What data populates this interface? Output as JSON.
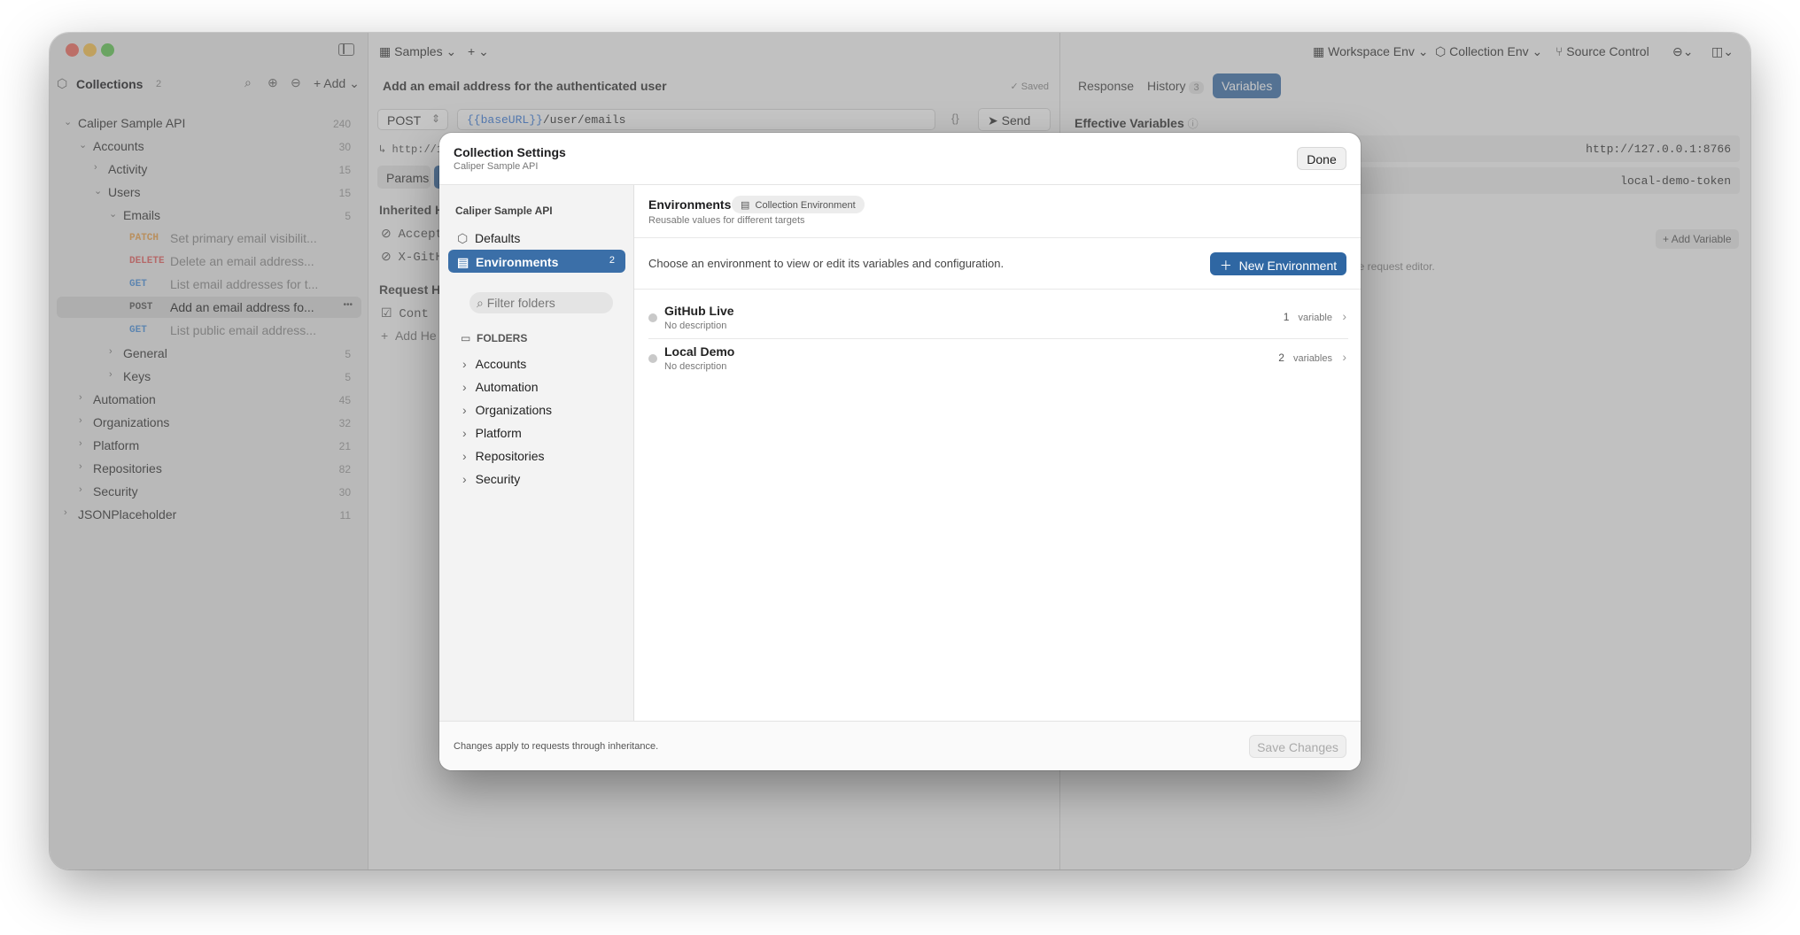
{
  "topbar": {
    "workspace_tab": "Samples",
    "add_tab": "+",
    "workspace_env": "Workspace Env",
    "collection_env": "Collection Env",
    "source_control": "Source Control"
  },
  "sidebar": {
    "title": "Collections",
    "title_count": "2",
    "add_label": "Add",
    "tree": [
      {
        "label": "Caliper Sample API",
        "count": "240"
      },
      {
        "label": "Accounts",
        "count": "30"
      },
      {
        "label": "Activity",
        "count": "15"
      },
      {
        "label": "Users",
        "count": "15"
      },
      {
        "label": "Emails",
        "count": "5"
      },
      {
        "method": "PATCH",
        "label": "Set primary email visibilit...",
        "color": "#e8a04a"
      },
      {
        "method": "DELETE",
        "label": "Delete an email address...",
        "color": "#e26060"
      },
      {
        "method": "GET",
        "label": "List email addresses for t...",
        "color": "#4a90d9"
      },
      {
        "method": "POST",
        "label": "Add an email address fo...",
        "color": "#555555"
      },
      {
        "method": "GET",
        "label": "List public email address...",
        "color": "#4a90d9"
      },
      {
        "label": "General",
        "count": "5"
      },
      {
        "label": "Keys",
        "count": "5"
      },
      {
        "label": "Automation",
        "count": "45"
      },
      {
        "label": "Organizations",
        "count": "32"
      },
      {
        "label": "Platform",
        "count": "21"
      },
      {
        "label": "Repositories",
        "count": "82"
      },
      {
        "label": "Security",
        "count": "30"
      },
      {
        "label": "JSONPlaceholder",
        "count": "11"
      }
    ]
  },
  "request": {
    "title": "Add an email address for the authenticated user",
    "saved": "Saved",
    "method": "POST",
    "url_var": "{{baseURL}}",
    "url_path": "/user/emails",
    "send": "Send",
    "resolved_url": "http://1",
    "params_tab": "Params",
    "inherited_headers": "Inherited H",
    "header1": "Accept",
    "header2": "X-GitH",
    "request_headers": "Request He",
    "header3": "Cont",
    "add_header": "Add He"
  },
  "right_panel": {
    "tabs": [
      "Response",
      "History",
      "Variables"
    ],
    "history_count": "3",
    "effective_vars": "Effective Variables",
    "var1_value": "http://127.0.0.1:8766",
    "var2_value": "local-demo-token",
    "add_variable": "Add Variable",
    "hint": "he request editor."
  },
  "modal": {
    "title": "Collection Settings",
    "subtitle": "Caliper Sample API",
    "done": "Done",
    "nav_header": "Caliper Sample API",
    "nav_defaults": "Defaults",
    "nav_environments": "Environments",
    "nav_env_count": "2",
    "filter_placeholder": "Filter folders",
    "folders_header": "FOLDERS",
    "folders": [
      "Accounts",
      "Automation",
      "Organizations",
      "Platform",
      "Repositories",
      "Security"
    ],
    "section_title": "Environments",
    "section_badge": "Collection Environment",
    "section_subtitle": "Reusable values for different targets",
    "choose_text": "Choose an environment to view or edit its variables and configuration.",
    "new_env": "New Environment",
    "environments": [
      {
        "name": "GitHub Live",
        "desc": "No description",
        "count": "1",
        "unit": "variable"
      },
      {
        "name": "Local Demo",
        "desc": "No description",
        "count": "2",
        "unit": "variables"
      }
    ],
    "footer_note": "Changes apply to requests through inheritance.",
    "save": "Save Changes"
  }
}
